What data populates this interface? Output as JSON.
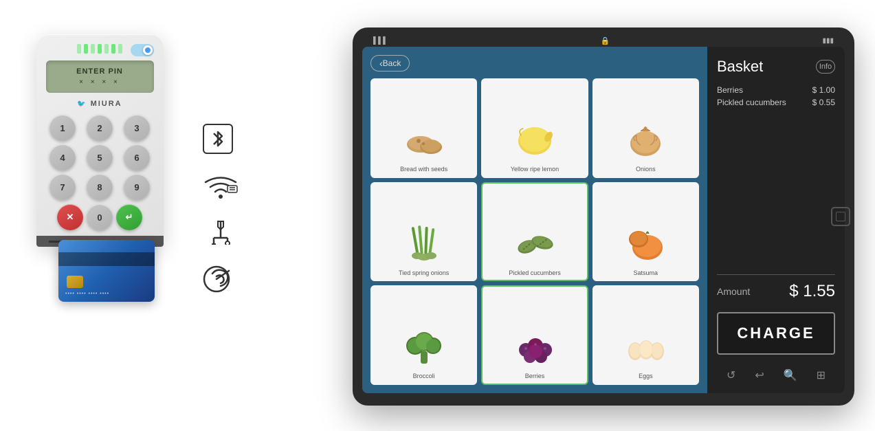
{
  "reader": {
    "lights": [
      1,
      2,
      3,
      4,
      5,
      6,
      7
    ],
    "screen": {
      "line1": "ENTER PIN",
      "line2": "× × × ×"
    },
    "logo": "MIURA",
    "keys": [
      "1",
      "2",
      "3",
      "4",
      "5",
      "6",
      "7",
      "8",
      "9"
    ],
    "key_cancel": "×",
    "key_zero": "0",
    "key_enter": "↵"
  },
  "connection_icons": [
    {
      "name": "bluetooth",
      "symbol": "bluetooth-icon"
    },
    {
      "name": "wifi",
      "symbol": "wifi-icon"
    },
    {
      "name": "usb",
      "symbol": "usb-icon"
    },
    {
      "name": "nfc",
      "symbol": "nfc-icon"
    }
  ],
  "tablet": {
    "status_bar": {
      "signal": "▌▌▌",
      "lock": "🔒",
      "battery": "▮▮▮"
    },
    "back_button": "Back",
    "products": [
      {
        "id": 1,
        "name": "Bread with seeds",
        "emoji": "🥔",
        "selected": false
      },
      {
        "id": 2,
        "name": "Yellow ripe lemon",
        "emoji": "🍋",
        "selected": false
      },
      {
        "id": 3,
        "name": "Onions",
        "emoji": "🧅",
        "selected": false
      },
      {
        "id": 4,
        "name": "Tied spring onions",
        "emoji": "🌿",
        "selected": false
      },
      {
        "id": 5,
        "name": "Pickled cucumbers",
        "emoji": "🥒",
        "selected": true
      },
      {
        "id": 6,
        "name": "Satsuma",
        "emoji": "🍊",
        "selected": false
      },
      {
        "id": 7,
        "name": "Broccoli",
        "emoji": "🥦",
        "selected": false
      },
      {
        "id": 8,
        "name": "Berries",
        "emoji": "🫐",
        "selected": true
      },
      {
        "id": 9,
        "name": "Eggs",
        "emoji": "🥚",
        "selected": false
      }
    ],
    "basket": {
      "title": "Basket",
      "info_label": "Info",
      "items": [
        {
          "name": "Berries",
          "price": "$ 1.00"
        },
        {
          "name": "Pickled cucumbers",
          "price": "$ 0.55"
        }
      ],
      "amount_label": "Amount",
      "total": "$ 1.55",
      "charge_label": "CHARGE"
    },
    "nav_icons": [
      "↺",
      "↩",
      "🔍",
      "⊞"
    ]
  }
}
